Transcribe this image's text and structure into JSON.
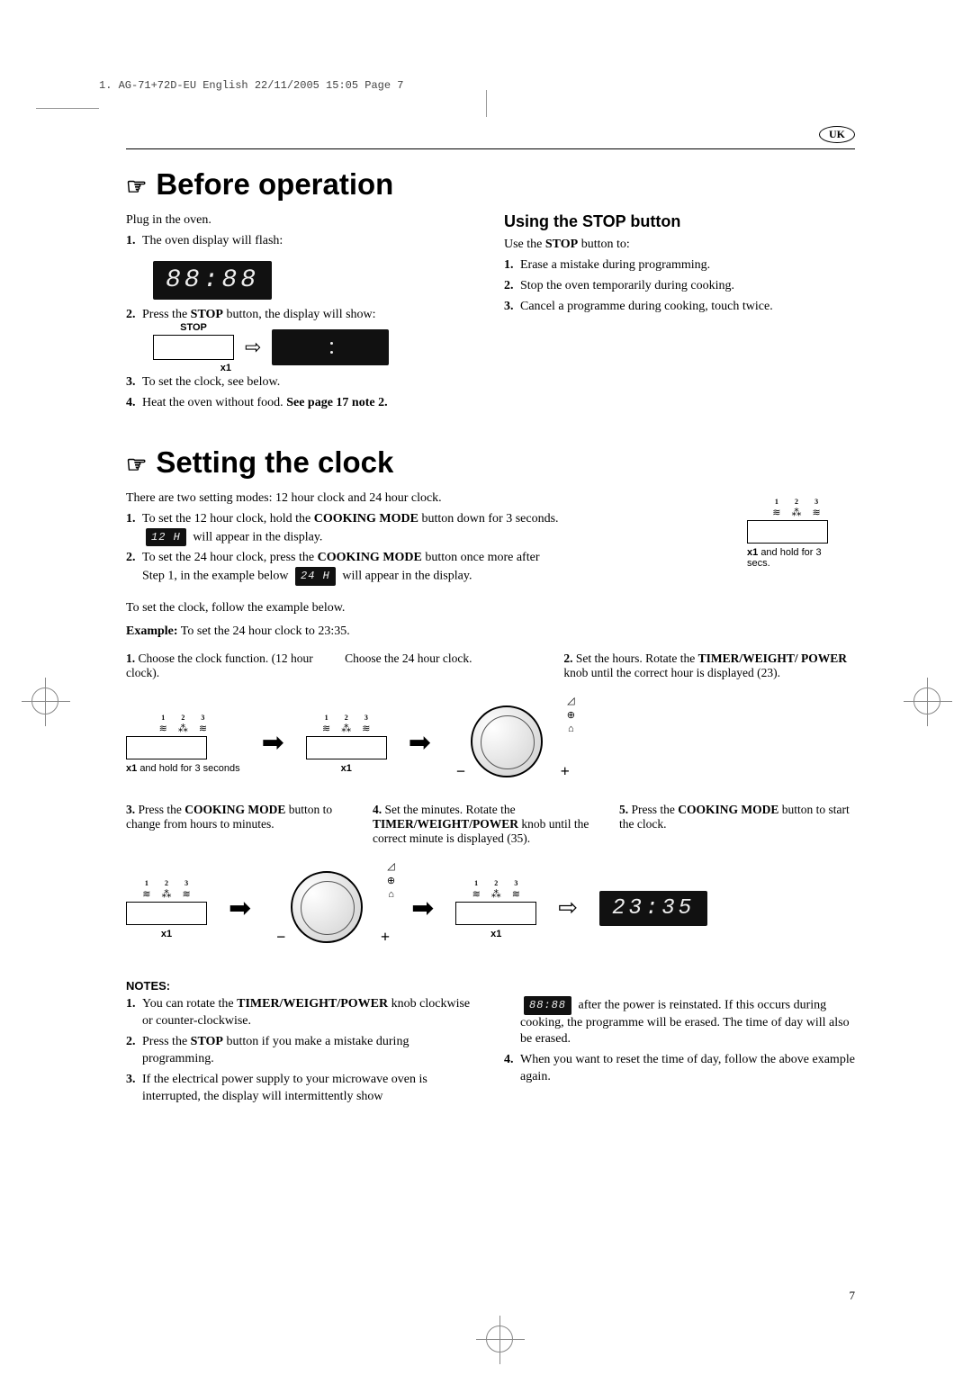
{
  "meta": {
    "header": "1. AG-71+72D-EU English  22/11/2005  15:05  Page 7",
    "region": "UK",
    "page_number": "7"
  },
  "section_before": {
    "title": "Before operation",
    "plug_in": "Plug in the oven.",
    "item1": "The oven display will flash:",
    "display1": "88:88",
    "item2_pre": "Press the ",
    "item2_bold": "STOP",
    "item2_post": " button, the display will show:",
    "stop_label": "STOP",
    "stop_times": "x1",
    "item3": "To set the clock, see below.",
    "item4_pre": "Heat the oven without food. ",
    "item4_bold": "See page 17 note 2."
  },
  "stop_button": {
    "title": "Using the STOP button",
    "intro_pre": "Use the ",
    "intro_bold": "STOP",
    "intro_post": " button to:",
    "item1": "Erase a mistake during programming.",
    "item2": "Stop the oven temporarily during cooking.",
    "item3": "Cancel a programme during cooking, touch twice."
  },
  "section_clock": {
    "title": "Setting the clock",
    "intro": "There are two setting modes: 12 hour clock and 24 hour clock.",
    "mode12_pre": "To set the 12 hour clock, hold the ",
    "mode12_bold": "COOKING MODE",
    "mode12_post": " button down for 3 seconds.",
    "mode12_badge": "12 H",
    "mode12_tail": " will appear in the display.",
    "mode24_pre": "To set the 24 hour clock, press the ",
    "mode24_bold": "COOKING MODE",
    "mode24_post": " button once more after",
    "mode24_line2_pre": "Step 1, in the example below ",
    "mode24_badge": "24 H",
    "mode24_tail": " will appear in the display.",
    "side_caption": "x1 and hold for 3 secs.",
    "follow": "To set the clock, follow the example below.",
    "example_label": "Example:",
    "example_text": " To set the 24 hour clock to 23:35.",
    "step1_text": "Choose the clock function. (12 hour clock).",
    "step1b_text": "Choose the 24 hour clock.",
    "step1_caption": "x1 and hold for 3 seconds",
    "step1b_caption": "x1",
    "step2_pre": "Set the hours. Rotate the ",
    "step2_bold": "TIMER/WEIGHT/ POWER",
    "step2_post": " knob until the correct hour is displayed (23).",
    "step3_pre": "Press the ",
    "step3_bold": "COOKING MODE",
    "step3_post": " button to change from hours to minutes.",
    "step3_caption": "x1",
    "step4_pre": "Set the minutes.  Rotate the ",
    "step4_bold": "TIMER/WEIGHT/POWER",
    "step4_post": " knob until the correct minute is displayed (35).",
    "step5_pre": "Press the ",
    "step5_bold": "COOKING MODE",
    "step5_post": " button to start the clock.",
    "step5_caption": "x1",
    "final_display": "23:35"
  },
  "notes": {
    "header": "NOTES:",
    "n1_pre": "You can rotate the ",
    "n1_bold": "TIMER/WEIGHT/POWER",
    "n1_post": " knob clockwise or counter-clockwise.",
    "n2_pre": "Press the ",
    "n2_bold": "STOP",
    "n2_post": " button if you make a mistake during programming.",
    "n3": "If the electrical power supply to your microwave oven is interrupted, the display will intermittently show",
    "n3_badge": "88:88",
    "n3_tail": " after the power is reinstated. If this occurs during cooking, the programme will be erased. The time of day will also be erased.",
    "n4": "When you want to reset the time of day, follow the above example again."
  },
  "icons": {
    "mode_numbers": [
      "1",
      "2",
      "3"
    ]
  }
}
